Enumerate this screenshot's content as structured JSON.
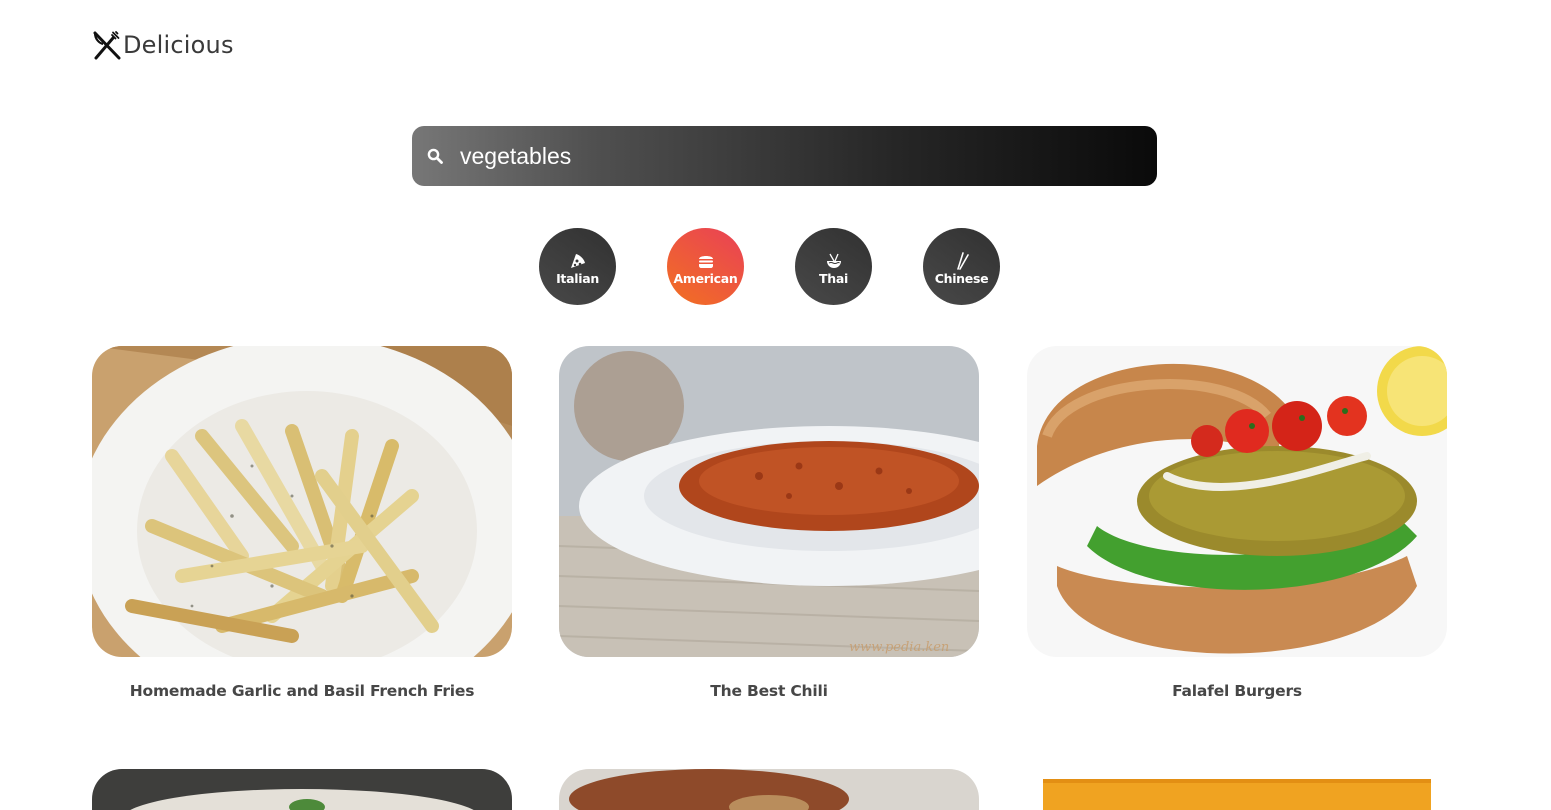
{
  "brand": {
    "name": "Delicious",
    "icon": "fork-knife-icon"
  },
  "search": {
    "value": "vegetables",
    "icon": "search-icon"
  },
  "categories": [
    {
      "label": "Italian",
      "icon": "pizza-icon",
      "active": false
    },
    {
      "label": "American",
      "icon": "hamburger-icon",
      "active": true
    },
    {
      "label": "Thai",
      "icon": "noodle-bowl-icon",
      "active": false
    },
    {
      "label": "Chinese",
      "icon": "chopsticks-icon",
      "active": false
    }
  ],
  "recipes": [
    {
      "title": "Homemade Garlic and Basil French Fries",
      "image": "fries-photo"
    },
    {
      "title": "The Best Chili",
      "image": "chili-photo"
    },
    {
      "title": "Falafel Burgers",
      "image": "falafel-burger-photo"
    },
    {
      "title": "",
      "image": "dish-photo-4"
    },
    {
      "title": "",
      "image": "dish-photo-5"
    },
    {
      "title": "",
      "image": "dish-photo-6"
    }
  ],
  "colors": {
    "accent_start": "#f27121",
    "accent_end": "#e94057",
    "category_bg": "#313131"
  }
}
